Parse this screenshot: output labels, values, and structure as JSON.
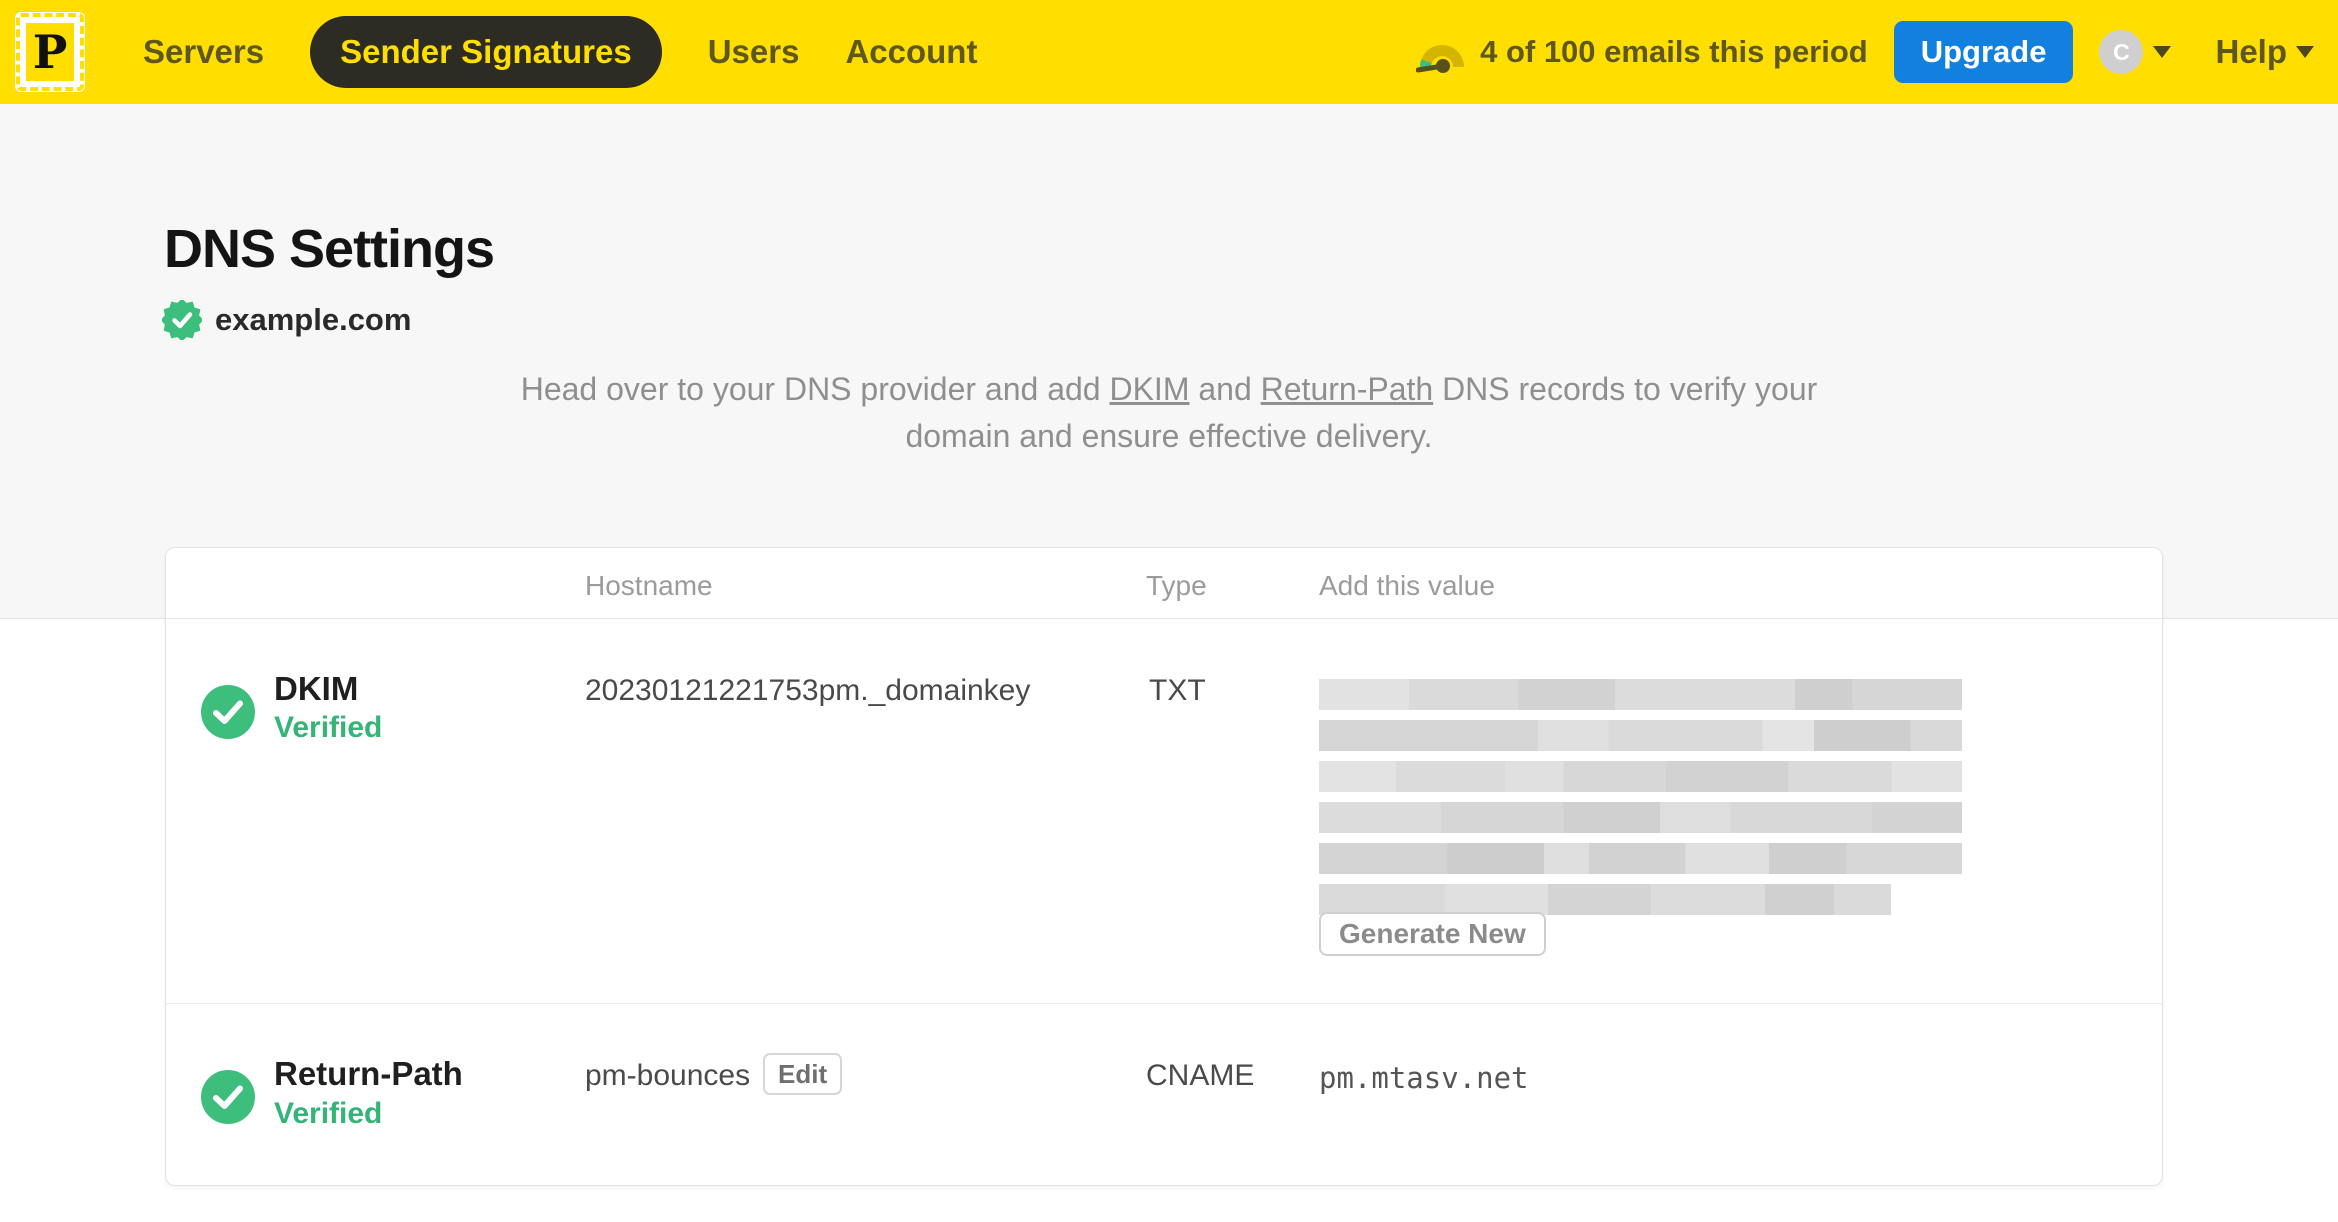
{
  "nav": {
    "brand_letter": "P",
    "items": [
      {
        "label": "Servers"
      },
      {
        "label": "Sender Signatures"
      },
      {
        "label": "Users"
      },
      {
        "label": "Account"
      }
    ],
    "active_item": "Sender Signatures",
    "usage_text": "4 of 100 emails this period",
    "upgrade_label": "Upgrade",
    "avatar_initial": "C",
    "help_label": "Help"
  },
  "page": {
    "title": "DNS Settings",
    "domain": "example.com",
    "domain_verified": true,
    "description": {
      "part1": "Head over to your DNS provider and add ",
      "link_dkim": "DKIM",
      "part2": " and ",
      "link_return_path": "Return-Path",
      "part3": " DNS records to verify your domain and ensure effective delivery."
    }
  },
  "table": {
    "headers": {
      "hostname": "Hostname",
      "type": "Type",
      "value": "Add this value"
    },
    "rows": [
      {
        "name": "DKIM",
        "status": "Verified",
        "hostname": "20230121221753pm._domainkey",
        "type": "TXT",
        "value_redacted": true,
        "action_label": "Generate New"
      },
      {
        "name": "Return-Path",
        "status": "Verified",
        "hostname": "pm-bounces",
        "edit_label": "Edit",
        "type": "CNAME",
        "value": "pm.mtasv.net"
      }
    ]
  },
  "colors": {
    "brand_yellow": "#FFDE00",
    "nav_text_olive": "#5e5820",
    "active_pill_bg": "#2d2c24",
    "upgrade_blue": "#1280df",
    "verified_green": "#34b577",
    "check_circle_green": "#3ebe7d",
    "hero_band_bg": "#f7f7f8",
    "muted_text": "#8f8f8f"
  }
}
